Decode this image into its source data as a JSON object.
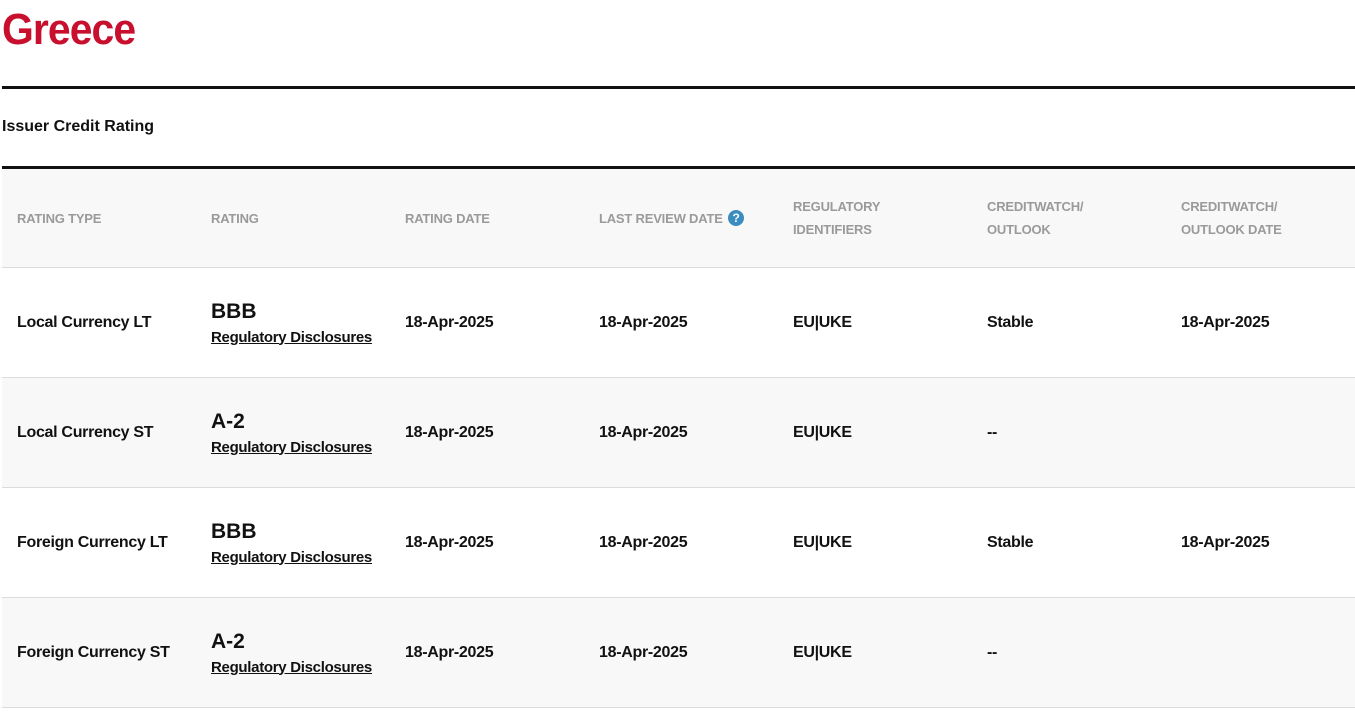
{
  "page": {
    "title": "Greece",
    "section_label": "Issuer Credit Rating"
  },
  "colors": {
    "title": "#c8102e",
    "header_text": "#9a9a9a",
    "help_icon": "#3b8dc0"
  },
  "table": {
    "columns": [
      {
        "label_line1": "RATING TYPE",
        "label_line2": ""
      },
      {
        "label_line1": "RATING",
        "label_line2": ""
      },
      {
        "label_line1": "RATING DATE",
        "label_line2": ""
      },
      {
        "label_line1": "LAST REVIEW DATE",
        "label_line2": "",
        "help_icon": "question-circle-icon",
        "help_glyph": "?"
      },
      {
        "label_line1": "REGULATORY",
        "label_line2": "IDENTIFIERS"
      },
      {
        "label_line1": "CREDITWATCH/",
        "label_line2": "OUTLOOK"
      },
      {
        "label_line1": "CREDITWATCH/",
        "label_line2": "OUTLOOK DATE"
      }
    ],
    "rows": [
      {
        "rating_type": "Local Currency LT",
        "rating": "BBB",
        "disclosure_link": "Regulatory Disclosures",
        "rating_date": "18-Apr-2025",
        "last_review_date": "18-Apr-2025",
        "regulatory_identifiers": "EU|UKE",
        "outlook": "Stable",
        "outlook_date": "18-Apr-2025"
      },
      {
        "rating_type": "Local Currency ST",
        "rating": "A-2",
        "disclosure_link": "Regulatory Disclosures",
        "rating_date": "18-Apr-2025",
        "last_review_date": "18-Apr-2025",
        "regulatory_identifiers": "EU|UKE",
        "outlook": "--",
        "outlook_date": ""
      },
      {
        "rating_type": "Foreign Currency LT",
        "rating": "BBB",
        "disclosure_link": "Regulatory Disclosures",
        "rating_date": "18-Apr-2025",
        "last_review_date": "18-Apr-2025",
        "regulatory_identifiers": "EU|UKE",
        "outlook": "Stable",
        "outlook_date": "18-Apr-2025"
      },
      {
        "rating_type": "Foreign Currency ST",
        "rating": "A-2",
        "disclosure_link": "Regulatory Disclosures",
        "rating_date": "18-Apr-2025",
        "last_review_date": "18-Apr-2025",
        "regulatory_identifiers": "EU|UKE",
        "outlook": "--",
        "outlook_date": ""
      }
    ]
  }
}
